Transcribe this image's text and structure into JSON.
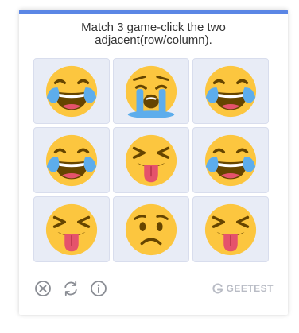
{
  "colors": {
    "accent": "#5b86e5",
    "tile_bg": "#e8ecf6",
    "emoji_yellow": "#fcc63f",
    "tear_blue": "#5dadec",
    "tongue_pink": "#e5526b",
    "icon_gray": "#8a8d94",
    "brand_gray": "#b9bcc5"
  },
  "captcha": {
    "instruction": "Match 3 game-click the two adjacent(row/column).",
    "tiles": [
      {
        "icon": "face-with-tears-of-joy-icon"
      },
      {
        "icon": "loudly-crying-face-icon"
      },
      {
        "icon": "face-with-tears-of-joy-icon"
      },
      {
        "icon": "face-with-tears-of-joy-icon"
      },
      {
        "icon": "squinting-face-with-tongue-icon"
      },
      {
        "icon": "face-with-tears-of-joy-icon"
      },
      {
        "icon": "squinting-face-with-tongue-icon"
      },
      {
        "icon": "worried-face-icon"
      },
      {
        "icon": "squinting-face-with-tongue-icon"
      }
    ]
  },
  "footer": {
    "close_icon": "close-icon",
    "refresh_icon": "refresh-icon",
    "info_icon": "info-icon",
    "brand_label": "GEETEST"
  }
}
